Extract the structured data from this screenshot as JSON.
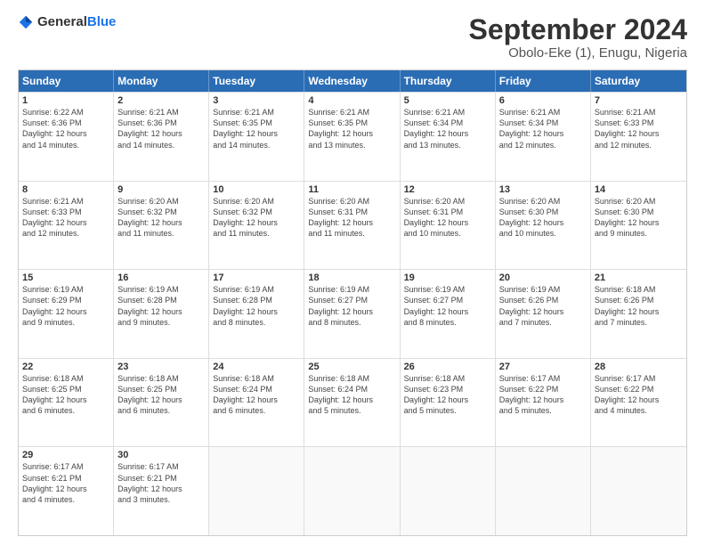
{
  "logo": {
    "general": "General",
    "blue": "Blue"
  },
  "title": "September 2024",
  "subtitle": "Obolo-Eke (1), Enugu, Nigeria",
  "header_days": [
    "Sunday",
    "Monday",
    "Tuesday",
    "Wednesday",
    "Thursday",
    "Friday",
    "Saturday"
  ],
  "weeks": [
    [
      {
        "day": "1",
        "lines": [
          "Sunrise: 6:22 AM",
          "Sunset: 6:36 PM",
          "Daylight: 12 hours",
          "and 14 minutes."
        ]
      },
      {
        "day": "2",
        "lines": [
          "Sunrise: 6:21 AM",
          "Sunset: 6:36 PM",
          "Daylight: 12 hours",
          "and 14 minutes."
        ]
      },
      {
        "day": "3",
        "lines": [
          "Sunrise: 6:21 AM",
          "Sunset: 6:35 PM",
          "Daylight: 12 hours",
          "and 14 minutes."
        ]
      },
      {
        "day": "4",
        "lines": [
          "Sunrise: 6:21 AM",
          "Sunset: 6:35 PM",
          "Daylight: 12 hours",
          "and 13 minutes."
        ]
      },
      {
        "day": "5",
        "lines": [
          "Sunrise: 6:21 AM",
          "Sunset: 6:34 PM",
          "Daylight: 12 hours",
          "and 13 minutes."
        ]
      },
      {
        "day": "6",
        "lines": [
          "Sunrise: 6:21 AM",
          "Sunset: 6:34 PM",
          "Daylight: 12 hours",
          "and 12 minutes."
        ]
      },
      {
        "day": "7",
        "lines": [
          "Sunrise: 6:21 AM",
          "Sunset: 6:33 PM",
          "Daylight: 12 hours",
          "and 12 minutes."
        ]
      }
    ],
    [
      {
        "day": "8",
        "lines": [
          "Sunrise: 6:21 AM",
          "Sunset: 6:33 PM",
          "Daylight: 12 hours",
          "and 12 minutes."
        ]
      },
      {
        "day": "9",
        "lines": [
          "Sunrise: 6:20 AM",
          "Sunset: 6:32 PM",
          "Daylight: 12 hours",
          "and 11 minutes."
        ]
      },
      {
        "day": "10",
        "lines": [
          "Sunrise: 6:20 AM",
          "Sunset: 6:32 PM",
          "Daylight: 12 hours",
          "and 11 minutes."
        ]
      },
      {
        "day": "11",
        "lines": [
          "Sunrise: 6:20 AM",
          "Sunset: 6:31 PM",
          "Daylight: 12 hours",
          "and 11 minutes."
        ]
      },
      {
        "day": "12",
        "lines": [
          "Sunrise: 6:20 AM",
          "Sunset: 6:31 PM",
          "Daylight: 12 hours",
          "and 10 minutes."
        ]
      },
      {
        "day": "13",
        "lines": [
          "Sunrise: 6:20 AM",
          "Sunset: 6:30 PM",
          "Daylight: 12 hours",
          "and 10 minutes."
        ]
      },
      {
        "day": "14",
        "lines": [
          "Sunrise: 6:20 AM",
          "Sunset: 6:30 PM",
          "Daylight: 12 hours",
          "and 9 minutes."
        ]
      }
    ],
    [
      {
        "day": "15",
        "lines": [
          "Sunrise: 6:19 AM",
          "Sunset: 6:29 PM",
          "Daylight: 12 hours",
          "and 9 minutes."
        ]
      },
      {
        "day": "16",
        "lines": [
          "Sunrise: 6:19 AM",
          "Sunset: 6:28 PM",
          "Daylight: 12 hours",
          "and 9 minutes."
        ]
      },
      {
        "day": "17",
        "lines": [
          "Sunrise: 6:19 AM",
          "Sunset: 6:28 PM",
          "Daylight: 12 hours",
          "and 8 minutes."
        ]
      },
      {
        "day": "18",
        "lines": [
          "Sunrise: 6:19 AM",
          "Sunset: 6:27 PM",
          "Daylight: 12 hours",
          "and 8 minutes."
        ]
      },
      {
        "day": "19",
        "lines": [
          "Sunrise: 6:19 AM",
          "Sunset: 6:27 PM",
          "Daylight: 12 hours",
          "and 8 minutes."
        ]
      },
      {
        "day": "20",
        "lines": [
          "Sunrise: 6:19 AM",
          "Sunset: 6:26 PM",
          "Daylight: 12 hours",
          "and 7 minutes."
        ]
      },
      {
        "day": "21",
        "lines": [
          "Sunrise: 6:18 AM",
          "Sunset: 6:26 PM",
          "Daylight: 12 hours",
          "and 7 minutes."
        ]
      }
    ],
    [
      {
        "day": "22",
        "lines": [
          "Sunrise: 6:18 AM",
          "Sunset: 6:25 PM",
          "Daylight: 12 hours",
          "and 6 minutes."
        ]
      },
      {
        "day": "23",
        "lines": [
          "Sunrise: 6:18 AM",
          "Sunset: 6:25 PM",
          "Daylight: 12 hours",
          "and 6 minutes."
        ]
      },
      {
        "day": "24",
        "lines": [
          "Sunrise: 6:18 AM",
          "Sunset: 6:24 PM",
          "Daylight: 12 hours",
          "and 6 minutes."
        ]
      },
      {
        "day": "25",
        "lines": [
          "Sunrise: 6:18 AM",
          "Sunset: 6:24 PM",
          "Daylight: 12 hours",
          "and 5 minutes."
        ]
      },
      {
        "day": "26",
        "lines": [
          "Sunrise: 6:18 AM",
          "Sunset: 6:23 PM",
          "Daylight: 12 hours",
          "and 5 minutes."
        ]
      },
      {
        "day": "27",
        "lines": [
          "Sunrise: 6:17 AM",
          "Sunset: 6:22 PM",
          "Daylight: 12 hours",
          "and 5 minutes."
        ]
      },
      {
        "day": "28",
        "lines": [
          "Sunrise: 6:17 AM",
          "Sunset: 6:22 PM",
          "Daylight: 12 hours",
          "and 4 minutes."
        ]
      }
    ],
    [
      {
        "day": "29",
        "lines": [
          "Sunrise: 6:17 AM",
          "Sunset: 6:21 PM",
          "Daylight: 12 hours",
          "and 4 minutes."
        ]
      },
      {
        "day": "30",
        "lines": [
          "Sunrise: 6:17 AM",
          "Sunset: 6:21 PM",
          "Daylight: 12 hours",
          "and 3 minutes."
        ]
      },
      {
        "day": "",
        "lines": []
      },
      {
        "day": "",
        "lines": []
      },
      {
        "day": "",
        "lines": []
      },
      {
        "day": "",
        "lines": []
      },
      {
        "day": "",
        "lines": []
      }
    ]
  ]
}
